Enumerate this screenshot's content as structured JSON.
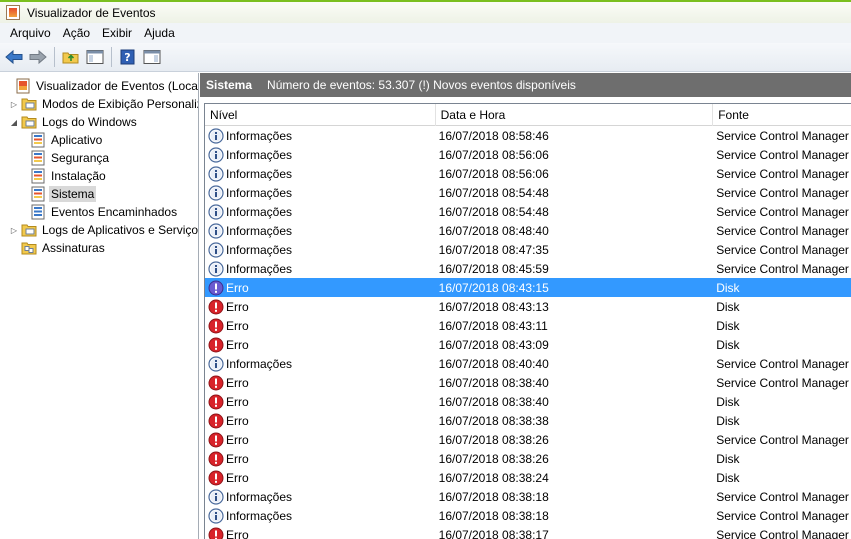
{
  "window": {
    "title": "Visualizador de Eventos"
  },
  "menu": [
    "Arquivo",
    "Ação",
    "Exibir",
    "Ajuda"
  ],
  "toolbar": {
    "icons": [
      "back-arrow-icon",
      "forward-arrow-icon",
      "folder-up-icon",
      "console-tree-icon",
      "help-icon",
      "action-pane-icon"
    ]
  },
  "tree": {
    "items": [
      {
        "label": "Visualizador de Eventos (Local)",
        "icon": "event-viewer-icon",
        "level": 0,
        "expander": ""
      },
      {
        "label": "Modos de Exibição Personalizados",
        "icon": "folder-icon",
        "level": 1,
        "expander": "collapsed"
      },
      {
        "label": "Logs do Windows",
        "icon": "folder-icon",
        "level": 1,
        "expander": "expanded"
      },
      {
        "label": "Aplicativo",
        "icon": "log-icon",
        "level": 2,
        "expander": ""
      },
      {
        "label": "Segurança",
        "icon": "log-icon",
        "level": 2,
        "expander": ""
      },
      {
        "label": "Instalação",
        "icon": "log-icon",
        "level": 2,
        "expander": ""
      },
      {
        "label": "Sistema",
        "icon": "log-icon",
        "level": 2,
        "expander": "",
        "selected": true
      },
      {
        "label": "Eventos Encaminhados",
        "icon": "log-icon",
        "level": 2,
        "expander": ""
      },
      {
        "label": "Logs de Aplicativos e Serviços",
        "icon": "folder-icon",
        "level": 1,
        "expander": "collapsed"
      },
      {
        "label": "Assinaturas",
        "icon": "subscriptions-icon",
        "level": 1,
        "expander": ""
      }
    ]
  },
  "panel": {
    "name": "Sistema",
    "info": "Número de eventos: 53.307 (!) Novos eventos disponíveis"
  },
  "table": {
    "columns": [
      "Nível",
      "Data e Hora",
      "Fonte"
    ],
    "rows": [
      {
        "level": "Informações",
        "type": "info",
        "datetime": "16/07/2018 08:58:46",
        "source": "Service Control Manager"
      },
      {
        "level": "Informações",
        "type": "info",
        "datetime": "16/07/2018 08:56:06",
        "source": "Service Control Manager"
      },
      {
        "level": "Informações",
        "type": "info",
        "datetime": "16/07/2018 08:56:06",
        "source": "Service Control Manager"
      },
      {
        "level": "Informações",
        "type": "info",
        "datetime": "16/07/2018 08:54:48",
        "source": "Service Control Manager"
      },
      {
        "level": "Informações",
        "type": "info",
        "datetime": "16/07/2018 08:54:48",
        "source": "Service Control Manager"
      },
      {
        "level": "Informações",
        "type": "info",
        "datetime": "16/07/2018 08:48:40",
        "source": "Service Control Manager"
      },
      {
        "level": "Informações",
        "type": "info",
        "datetime": "16/07/2018 08:47:35",
        "source": "Service Control Manager"
      },
      {
        "level": "Informações",
        "type": "info",
        "datetime": "16/07/2018 08:45:59",
        "source": "Service Control Manager"
      },
      {
        "level": "Erro",
        "type": "error",
        "datetime": "16/07/2018 08:43:15",
        "source": "Disk",
        "selected": true
      },
      {
        "level": "Erro",
        "type": "error",
        "datetime": "16/07/2018 08:43:13",
        "source": "Disk"
      },
      {
        "level": "Erro",
        "type": "error",
        "datetime": "16/07/2018 08:43:11",
        "source": "Disk"
      },
      {
        "level": "Erro",
        "type": "error",
        "datetime": "16/07/2018 08:43:09",
        "source": "Disk"
      },
      {
        "level": "Informações",
        "type": "info",
        "datetime": "16/07/2018 08:40:40",
        "source": "Service Control Manager"
      },
      {
        "level": "Erro",
        "type": "error",
        "datetime": "16/07/2018 08:38:40",
        "source": "Service Control Manager"
      },
      {
        "level": "Erro",
        "type": "error",
        "datetime": "16/07/2018 08:38:40",
        "source": "Disk"
      },
      {
        "level": "Erro",
        "type": "error",
        "datetime": "16/07/2018 08:38:38",
        "source": "Disk"
      },
      {
        "level": "Erro",
        "type": "error",
        "datetime": "16/07/2018 08:38:26",
        "source": "Service Control Manager"
      },
      {
        "level": "Erro",
        "type": "error",
        "datetime": "16/07/2018 08:38:26",
        "source": "Disk"
      },
      {
        "level": "Erro",
        "type": "error",
        "datetime": "16/07/2018 08:38:24",
        "source": "Disk"
      },
      {
        "level": "Informações",
        "type": "info",
        "datetime": "16/07/2018 08:38:18",
        "source": "Service Control Manager"
      },
      {
        "level": "Informações",
        "type": "info",
        "datetime": "16/07/2018 08:38:18",
        "source": "Service Control Manager"
      },
      {
        "level": "Erro",
        "type": "error",
        "datetime": "16/07/2018 08:38:17",
        "source": "Service Control Manager"
      }
    ]
  },
  "colors": {
    "title_accent": "#7bbf1f",
    "header_bar": "#6e6e6e",
    "selection": "#3399ff",
    "error_icon": "#d8232a",
    "info_icon": "#3a5f9e"
  }
}
